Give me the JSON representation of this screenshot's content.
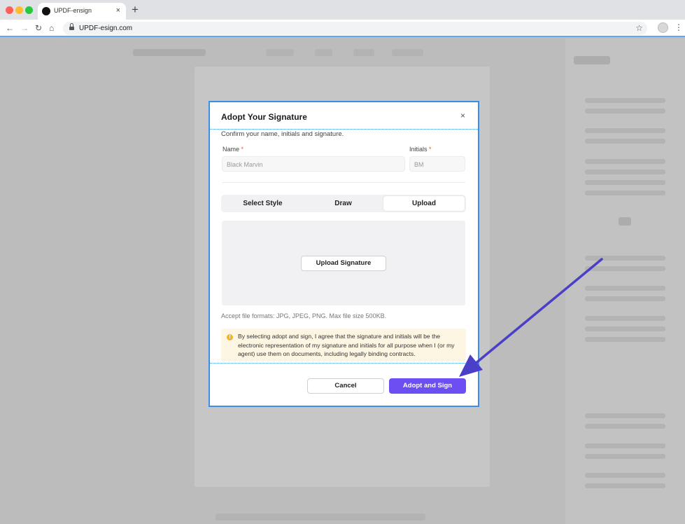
{
  "browser": {
    "tab_title": "UPDF-ensign",
    "tab_close": "×",
    "new_tab": "+",
    "url": "UPDF-esign.com"
  },
  "modal": {
    "title": "Adopt Your Signature",
    "close": "×",
    "subtitle": "Confirm your name, initials and signature.",
    "name_label": "Name",
    "initials_label": "Initials",
    "required_mark": "*",
    "name_placeholder": "Black Marvin",
    "initials_placeholder": "BM",
    "tabs": [
      {
        "label": "Select Style",
        "active": false
      },
      {
        "label": "Draw",
        "active": false
      },
      {
        "label": "Upload",
        "active": true
      }
    ],
    "upload_button": "Upload Signature",
    "formats_note": "Accept file formats: JPG, JPEG, PNG. Max file size 500KB.",
    "notice": "By selecting adopt and sign, I agree that the signature and initials will be the electronic representation of my signature and initials for all purpose when I (or my agent) use them on documents, including legally binding contracts.",
    "cancel_button": "Cancel",
    "adopt_button": "Adopt and Sign"
  },
  "colors": {
    "accent": "#6c4ef2",
    "focus_border": "#3a8ee6",
    "annotation_arrow": "#4a3fc6",
    "notice_bg": "#fdf6e3"
  }
}
